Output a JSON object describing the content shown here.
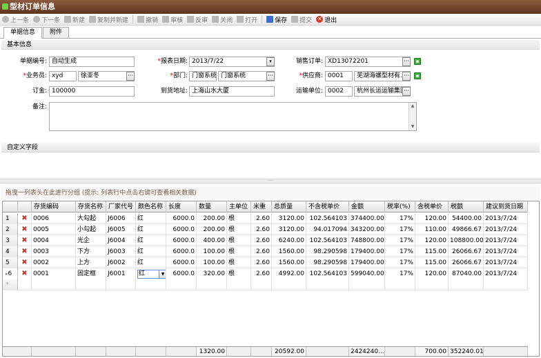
{
  "window": {
    "title": "型材订单信息"
  },
  "toolbar": [
    {
      "label": "上一条",
      "icon": "prev-icon",
      "enabled": false
    },
    {
      "label": "下一条",
      "icon": "next-icon",
      "enabled": false
    },
    {
      "label": "新建",
      "icon": "plus-icon",
      "enabled": false
    },
    {
      "label": "复制并新建",
      "icon": "copy-icon",
      "enabled": false
    },
    {
      "label": "撤销",
      "icon": "undo-icon",
      "enabled": false
    },
    {
      "label": "审核",
      "icon": "approve-icon",
      "enabled": false
    },
    {
      "label": "反审",
      "icon": "unapprove-icon",
      "enabled": false
    },
    {
      "label": "关闭",
      "icon": "close-doc-icon",
      "enabled": false
    },
    {
      "label": "打开",
      "icon": "open-doc-icon",
      "enabled": false
    },
    {
      "label": "保存",
      "icon": "save-icon",
      "enabled": true
    },
    {
      "label": "提交",
      "icon": "submit-icon",
      "enabled": false
    },
    {
      "label": "退出",
      "icon": "exit-icon",
      "enabled": true
    }
  ],
  "tabs": [
    "单据信息",
    "附件"
  ],
  "basic": {
    "section": "基本信息",
    "doc_no_label": "单据编号:",
    "doc_no": "自动生成",
    "report_date_label": "报表日期:",
    "report_date": "2013/7/22",
    "sales_order_label": "销售订单:",
    "sales_order": "XD13072201",
    "salesman_label": "业务员:",
    "salesman_code": "xyd",
    "salesman_name": "徐亚冬",
    "dept_label": "部门:",
    "dept_code": "门窗系统",
    "dept_name": "门窗系统",
    "supplier_label": "供应商:",
    "supplier_code": "0001",
    "supplier_name": "芜湖海螺型材有...",
    "deposit_label": "订金:",
    "deposit": "100000",
    "address_label": "到货地址:",
    "address": "上海山水大厦",
    "carrier_label": "运输单位:",
    "carrier_code": "0002",
    "carrier_name": "杭州长运运输集团",
    "note_label": "备注:"
  },
  "custom": {
    "section": "自定义字段"
  },
  "group_hint": "拖曳一列表头在此进行分组 (提示: 列表行中点击右键可查看相关数据)",
  "grid": {
    "columns": [
      "存货编码",
      "存货名称",
      "厂家代号",
      "颜色名称",
      "长度",
      "数量",
      "主单位",
      "米重",
      "总质量",
      "不含税单价",
      "金额",
      "税率(%)",
      "含税单价",
      "税额",
      "建议到货日期"
    ],
    "rows": [
      {
        "n": "1",
        "code": "0006",
        "name": "大勾起",
        "factory": "J6006",
        "color": "红",
        "length": "6000.0",
        "qty": "200.00",
        "unit": "根",
        "mw": "2.60",
        "total": "3120.00",
        "price": "102.564103",
        "amount": "374400.00",
        "rate": "17%",
        "taxprice": "120.00",
        "tax": "54400.00",
        "date": "2013/7/24"
      },
      {
        "n": "2",
        "code": "0005",
        "name": "小勾起",
        "factory": "J6005",
        "color": "红",
        "length": "6000.0",
        "qty": "200.00",
        "unit": "根",
        "mw": "2.60",
        "total": "3120.00",
        "price": "94.017094",
        "amount": "343200.00",
        "rate": "17%",
        "taxprice": "110.00",
        "tax": "49866.67",
        "date": "2013/7/24"
      },
      {
        "n": "3",
        "code": "0004",
        "name": "光企",
        "factory": "J6004",
        "color": "红",
        "length": "6000.0",
        "qty": "400.00",
        "unit": "根",
        "mw": "2.60",
        "total": "6240.00",
        "price": "102.564103",
        "amount": "748800.00",
        "rate": "17%",
        "taxprice": "120.00",
        "tax": "108800.00",
        "date": "2013/7/24"
      },
      {
        "n": "4",
        "code": "0003",
        "name": "下方",
        "factory": "J6003",
        "color": "红",
        "length": "6000.0",
        "qty": "100.00",
        "unit": "根",
        "mw": "2.60",
        "total": "1560.00",
        "price": "98.290598",
        "amount": "179400.00",
        "rate": "17%",
        "taxprice": "115.00",
        "tax": "26066.67",
        "date": "2013/7/24"
      },
      {
        "n": "5",
        "code": "0002",
        "name": "上方",
        "factory": "J6002",
        "color": "红",
        "length": "6000.0",
        "qty": "100.00",
        "unit": "根",
        "mw": "2.60",
        "total": "1560.00",
        "price": "98.290598",
        "amount": "179400.00",
        "rate": "17%",
        "taxprice": "115.00",
        "tax": "26066.67",
        "date": "2013/7/24"
      },
      {
        "n": "6",
        "code": "0001",
        "name": "固定框",
        "factory": "J6001",
        "color": "红",
        "length": "6000.0",
        "qty": "320.00",
        "unit": "根",
        "mw": "2.60",
        "total": "4992.00",
        "price": "102.564103",
        "amount": "599040.00",
        "rate": "17%",
        "taxprice": "120.00",
        "tax": "87040.00",
        "date": "2013/7/24"
      }
    ],
    "current_row_marker": "▸",
    "new_row_marker": "*",
    "totals": {
      "qty": "1320.00",
      "total": "20592.00",
      "amount": "2424240...",
      "taxprice": "700.00",
      "tax": "352240.01"
    }
  }
}
